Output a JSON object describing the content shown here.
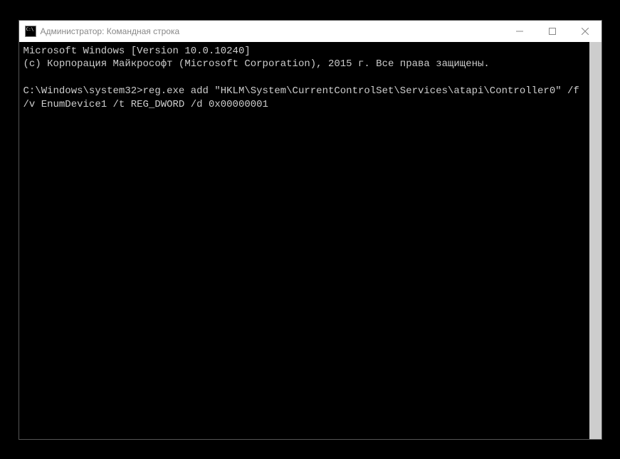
{
  "window": {
    "title": "Администратор: Командная строка"
  },
  "terminal": {
    "line1": "Microsoft Windows [Version 10.0.10240]",
    "line2": "(c) Корпорация Майкрософт (Microsoft Corporation), 2015 г. Все права защищены.",
    "blank": "",
    "prompt_full": "C:\\Windows\\system32>reg.exe add \"HKLM\\System\\CurrentControlSet\\Services\\atapi\\Controller0\" /f /v EnumDevice1 /t REG_DWORD /d 0x00000001"
  }
}
